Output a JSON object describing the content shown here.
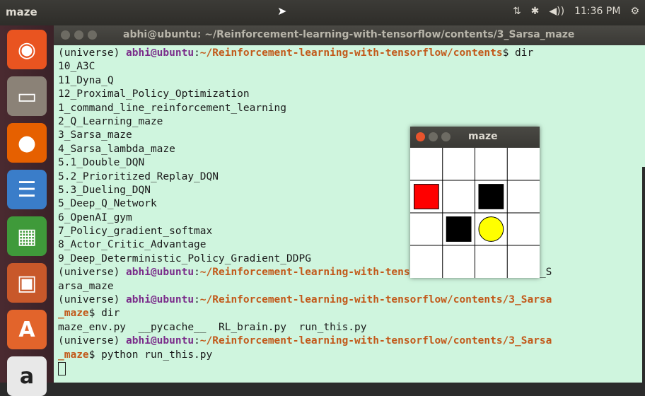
{
  "topbar": {
    "app_name": "maze",
    "clock": "11:36 PM",
    "indicator_icons": [
      "network-icon",
      "bluetooth-icon",
      "volume-icon",
      "settings-icon"
    ],
    "network_glyph": "⇅",
    "bluetooth_glyph": "✱",
    "volume_glyph": "◀))",
    "settings_glyph": "⚙"
  },
  "launcher": {
    "items": [
      {
        "name": "ubuntu-dash",
        "glyph": "◉",
        "color": "#e95420"
      },
      {
        "name": "files",
        "glyph": "▭",
        "color": "#8b8277"
      },
      {
        "name": "firefox",
        "glyph": "●",
        "color": "#e66000"
      },
      {
        "name": "libreoffice-writer",
        "glyph": "☰",
        "color": "#3a7dc9"
      },
      {
        "name": "libreoffice-calc",
        "glyph": "▦",
        "color": "#3f9a3a"
      },
      {
        "name": "libreoffice-impress",
        "glyph": "▣",
        "color": "#c8582a"
      },
      {
        "name": "software-center",
        "glyph": "A",
        "color": "#e2642b"
      },
      {
        "name": "amazon",
        "glyph": "a",
        "color": "#e8e8e8"
      }
    ]
  },
  "terminal": {
    "title": "abhi@ubuntu: ~/Reinforcement-learning-with-tensorflow/contents/3_Sarsa_maze",
    "lines": [
      [
        {
          "c": "pl",
          "t": "(universe) "
        },
        {
          "c": "user",
          "t": "abhi@ubuntu"
        },
        {
          "c": "pl",
          "t": ":"
        },
        {
          "c": "path",
          "t": "~/Reinforcement-learning-with-tensorflow/contents"
        },
        {
          "c": "pl",
          "t": "$ dir"
        }
      ],
      [
        {
          "c": "pl",
          "t": "10_A3C"
        }
      ],
      [
        {
          "c": "pl",
          "t": "11_Dyna_Q"
        }
      ],
      [
        {
          "c": "pl",
          "t": "12_Proximal_Policy_Optimization"
        }
      ],
      [
        {
          "c": "pl",
          "t": "1_command_line_reinforcement_learning"
        }
      ],
      [
        {
          "c": "pl",
          "t": "2_Q_Learning_maze"
        }
      ],
      [
        {
          "c": "pl",
          "t": "3_Sarsa_maze"
        }
      ],
      [
        {
          "c": "pl",
          "t": "4_Sarsa_lambda_maze"
        }
      ],
      [
        {
          "c": "pl",
          "t": "5.1_Double_DQN"
        }
      ],
      [
        {
          "c": "pl",
          "t": "5.2_Prioritized_Replay_DQN"
        }
      ],
      [
        {
          "c": "pl",
          "t": "5.3_Dueling_DQN"
        }
      ],
      [
        {
          "c": "pl",
          "t": "5_Deep_Q_Network"
        }
      ],
      [
        {
          "c": "pl",
          "t": "6_OpenAI_gym"
        }
      ],
      [
        {
          "c": "pl",
          "t": "7_Policy_gradient_softmax"
        }
      ],
      [
        {
          "c": "pl",
          "t": "8_Actor_Critic_Advantage"
        }
      ],
      [
        {
          "c": "pl",
          "t": "9_Deep_Deterministic_Policy_Gradient_DDPG"
        }
      ],
      [
        {
          "c": "pl",
          "t": "(universe) "
        },
        {
          "c": "user",
          "t": "abhi@ubuntu"
        },
        {
          "c": "pl",
          "t": ":"
        },
        {
          "c": "path",
          "t": "~/Reinforcement-learning-with-tensorflow/contents"
        },
        {
          "c": "pl",
          "t": "$ cd 3_S"
        }
      ],
      [
        {
          "c": "pl",
          "t": "arsa_maze"
        }
      ],
      [
        {
          "c": "pl",
          "t": "(universe) "
        },
        {
          "c": "user",
          "t": "abhi@ubuntu"
        },
        {
          "c": "pl",
          "t": ":"
        },
        {
          "c": "path",
          "t": "~/Reinforcement-learning-with-tensorflow/contents/3_Sarsa"
        }
      ],
      [
        {
          "c": "path",
          "t": "_maze"
        },
        {
          "c": "pl",
          "t": "$ dir"
        }
      ],
      [
        {
          "c": "pl",
          "t": "maze_env.py  __pycache__  RL_brain.py  run_this.py"
        }
      ],
      [
        {
          "c": "pl",
          "t": "(universe) "
        },
        {
          "c": "user",
          "t": "abhi@ubuntu"
        },
        {
          "c": "pl",
          "t": ":"
        },
        {
          "c": "path",
          "t": "~/Reinforcement-learning-with-tensorflow/contents/3_Sarsa"
        }
      ],
      [
        {
          "c": "path",
          "t": "_maze"
        },
        {
          "c": "pl",
          "t": "$ python run_this.py"
        }
      ],
      [
        {
          "c": "caret",
          "t": ""
        }
      ]
    ]
  },
  "maze_window": {
    "title": "maze",
    "rows": 4,
    "cols": 4,
    "cells": [
      {
        "row": 1,
        "col": 0,
        "kind": "agent",
        "color": "#ff0000"
      },
      {
        "row": 1,
        "col": 2,
        "kind": "hell",
        "color": "#000000"
      },
      {
        "row": 2,
        "col": 1,
        "kind": "hell",
        "color": "#000000"
      },
      {
        "row": 2,
        "col": 2,
        "kind": "goal",
        "color": "#ffff00"
      }
    ]
  }
}
